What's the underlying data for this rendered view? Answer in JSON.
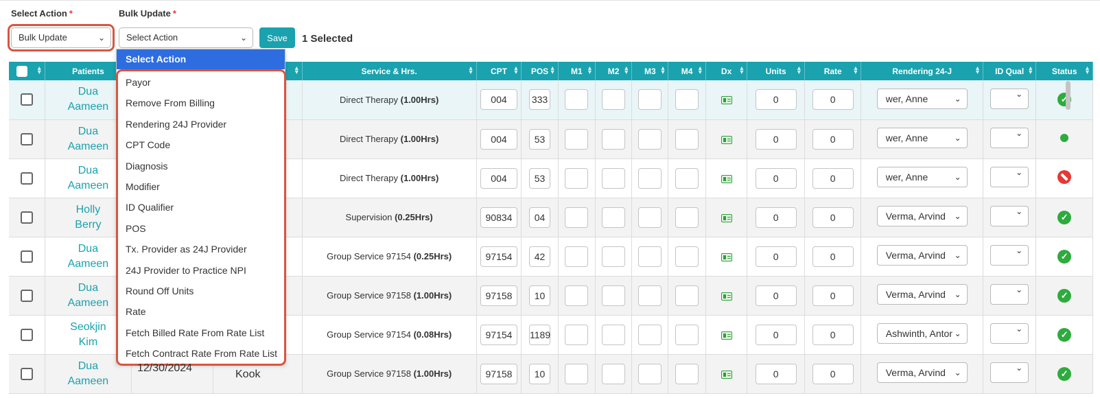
{
  "form": {
    "select_action_label": "Select Action",
    "bulk_update_label": "Bulk Update",
    "required_mark": "*",
    "action_value": "Bulk Update",
    "bulk_value": "Select Action",
    "save_label": "Save",
    "selected_text": "1 Selected"
  },
  "dropdown": {
    "header": "Select Action",
    "items": [
      "Payor",
      "Remove From Billing",
      "Rendering 24J Provider",
      "CPT Code",
      "Diagnosis",
      "Modifier",
      "ID Qualifier",
      "POS",
      "Tx. Provider as 24J Provider",
      "24J Provider to Practice NPI",
      "Round Off Units",
      "Rate",
      "Fetch Billed Rate From Rate List",
      "Fetch Contract Rate From Rate List"
    ]
  },
  "table": {
    "headers": {
      "patients": "Patients",
      "service": "Service & Hrs.",
      "cpt": "CPT",
      "pos": "POS",
      "m1": "M1",
      "m2": "M2",
      "m3": "M3",
      "m4": "M4",
      "dx": "Dx",
      "units": "Units",
      "rate": "Rate",
      "rendering": "Rendering 24-J",
      "idqual": "ID Qual",
      "status": "Status"
    },
    "rows": [
      {
        "patient_first": "Dua",
        "patient_last": "Aameen",
        "service": "Direct Therapy",
        "hours": "(1.00Hrs)",
        "cpt": "004",
        "pos": "333",
        "units": "0",
        "rate": "0",
        "rendering": "wer, Anne",
        "status": "check"
      },
      {
        "patient_first": "Dua",
        "patient_last": "Aameen",
        "service": "Direct Therapy",
        "hours": "(1.00Hrs)",
        "cpt": "004",
        "pos": "53",
        "units": "0",
        "rate": "0",
        "rendering": "wer, Anne",
        "status": "dot"
      },
      {
        "patient_first": "Dua",
        "patient_last": "Aameen",
        "service": "Direct Therapy",
        "hours": "(1.00Hrs)",
        "cpt": "004",
        "pos": "53",
        "units": "0",
        "rate": "0",
        "rendering": "wer, Anne",
        "status": "blocked"
      },
      {
        "patient_first": "Holly",
        "patient_last": "Berry",
        "service": "Supervision",
        "hours": "(0.25Hrs)",
        "cpt": "90834",
        "pos": "04",
        "units": "0",
        "rate": "0",
        "rendering": "Verma, Arvind",
        "status": "check"
      },
      {
        "patient_first": "Dua",
        "patient_last": "Aameen",
        "service": "Group Service 97154",
        "hours": "(0.25Hrs)",
        "cpt": "97154",
        "pos": "42",
        "units": "0",
        "rate": "0",
        "rendering": "Verma, Arvind",
        "status": "check"
      },
      {
        "patient_first": "Dua",
        "patient_last": "Aameen",
        "service": "Group Service 97158",
        "hours": "(1.00Hrs)",
        "cpt": "97158",
        "pos": "10",
        "units": "0",
        "rate": "0",
        "rendering": "Verma, Arvind",
        "status": "check"
      },
      {
        "patient_first": "Seokjin",
        "patient_last": "Kim",
        "service": "Group Service 97154",
        "hours": "(0.08Hrs)",
        "cpt": "97154",
        "pos": "1189",
        "units": "0",
        "rate": "0",
        "rendering": "Ashwinth, Antony",
        "status": "check"
      },
      {
        "patient_first": "Dua",
        "patient_last": "Aameen",
        "service": "Group Service 97158",
        "hours": "(1.00Hrs)",
        "cpt": "97158",
        "pos": "10",
        "units": "0",
        "rate": "0",
        "rendering": "Verma, Arvind",
        "status": "check"
      }
    ],
    "partial_visible": {
      "date": "12/30/2024",
      "provider": "Kook"
    }
  },
  "colors": {
    "header_bg": "#1aa2ae",
    "dropdown_active": "#2d6de0",
    "highlight_border": "#d9553f",
    "status_ok": "#2eab3d",
    "status_blocked": "#e53935"
  },
  "icons": {
    "chevron": "chevron-down-icon",
    "sort": "sort-icon",
    "dx": "id-card-icon",
    "status_check": "check-circle-icon",
    "status_dot": "dot-icon",
    "status_blocked": "no-entry-icon"
  }
}
